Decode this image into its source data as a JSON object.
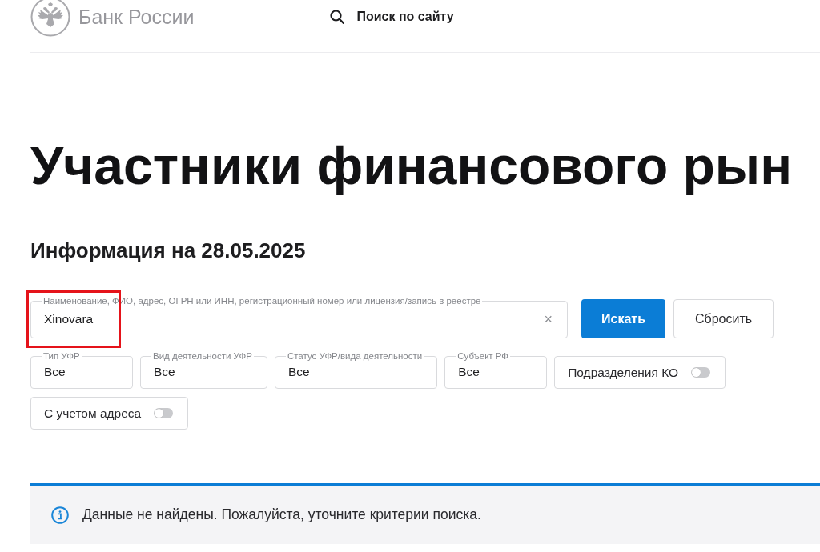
{
  "header": {
    "logo_text": "Банк России",
    "search_link": "Поиск по сайту"
  },
  "page_title": "Участники финансового рын",
  "info_date": "Информация на 28.05.2025",
  "search": {
    "label": "Наименование, ФИО, адрес, ОГРН или ИНН, регистрационный номер или лицензия/запись в реестре",
    "value": "Xinovara",
    "clear": "×",
    "highlighted": true
  },
  "buttons": [
    {
      "label": "Искать",
      "kind": "primary"
    },
    {
      "label": "Сбросить",
      "kind": "secondary"
    }
  ],
  "filters": [
    {
      "kind": "select",
      "label": "Тип УФР",
      "value": "Все"
    },
    {
      "kind": "select",
      "label": "Вид деятельности УФР",
      "value": "Все"
    },
    {
      "kind": "select",
      "label": "Статус УФР/вида деятельности",
      "value": "Все"
    },
    {
      "kind": "select",
      "label": "Субъект РФ",
      "value": "Все"
    },
    {
      "kind": "toggle",
      "label": "Подразделения КО",
      "on": false
    },
    {
      "kind": "toggle",
      "label": "С учетом адреса",
      "on": false
    }
  ],
  "notice": {
    "text": "Данные не найдены. Пожалуйста, уточните критерии поиска."
  }
}
